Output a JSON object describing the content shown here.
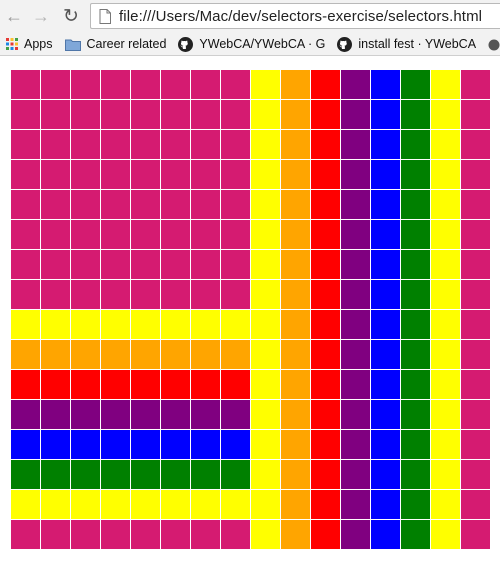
{
  "browser": {
    "url": "file:///Users/Mac/dev/selectors-exercise/selectors.html",
    "bookmarks": [
      {
        "label": "Apps",
        "icon": "apps-grid-icon"
      },
      {
        "label": "Career related",
        "icon": "folder-icon"
      },
      {
        "label": "YWebCA/YWebCA · G",
        "icon": "github-icon"
      },
      {
        "label": "install fest · YWebCA",
        "icon": "github-icon"
      }
    ]
  },
  "colors": {
    "M": "#d51b71",
    "Y": "#ffff00",
    "O": "#ffa500",
    "R": "#ff0000",
    "P": "#800080",
    "B": "#0000ff",
    "G": "#008000"
  },
  "grid_rows": [
    "MMMMMMMMYORPBGYM",
    "MMMMMMMMYORPBGYM",
    "MMMMMMMMYORPBGYM",
    "MMMMMMMMYORPBGYM",
    "MMMMMMMMYORPBGYM",
    "MMMMMMMMYORPBGYM",
    "MMMMMMMMYORPBGYM",
    "MMMMMMMMYORPBGYM",
    "YYYYYYYYYORPBGYM",
    "OOOOOOOOYORPBGYM",
    "RRRRRRRRYORPBGYM",
    "PPPPPPPPYORPBGYM",
    "BBBBBBBBYORPBGYM",
    "GGGGGGGGYORPBGYM",
    "YYYYYYYYYORPBGYM",
    "MMMMMMMMYORPBGYM"
  ]
}
